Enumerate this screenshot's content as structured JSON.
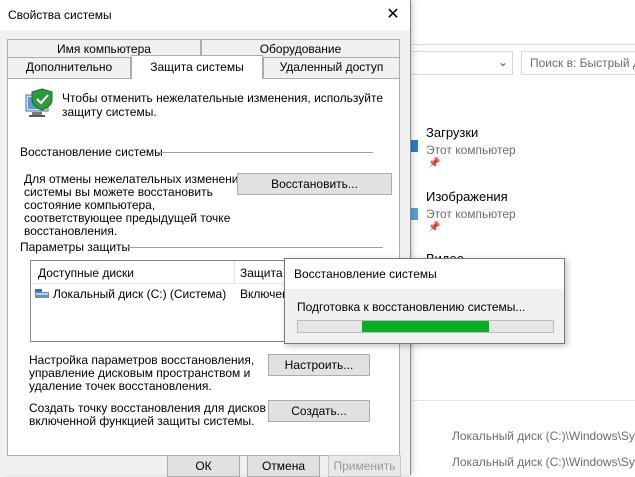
{
  "explorer": {
    "search_placeholder": "Поиск в: Быстрый д",
    "quick_access": [
      {
        "title": "Загрузки",
        "subtitle": "Этот компьютер"
      },
      {
        "title": "Изображения",
        "subtitle": "Этот компьютер"
      },
      {
        "title": "Видео",
        "subtitle": ""
      }
    ],
    "recent_paths": [
      "Локальный диск (C:)\\Windows\\Sy",
      "Локальный диск (C:)\\Windows\\Sy"
    ]
  },
  "dialog": {
    "title": "Свойства системы",
    "tabs_row1": [
      "Имя компьютера",
      "Оборудование"
    ],
    "tabs_row2": [
      "Дополнительно",
      "Защита системы",
      "Удаленный доступ"
    ],
    "active_tab": "Защита системы",
    "intro_line1": "Чтобы отменить нежелательные изменения, используйте",
    "intro_line2": "защиту системы.",
    "restore_group": "Восстановление системы",
    "restore_text": [
      "Для отмены нежелательных изменений",
      "системы вы можете восстановить",
      "состояние компьютера,",
      "соответствующее предыдущей точке",
      "восстановления."
    ],
    "restore_button": "Восстановить...",
    "protection_group": "Параметры защиты",
    "list": {
      "col_drives": "Доступные диски",
      "col_protection": "Защита",
      "rows": [
        {
          "drive": "Локальный диск (C:) (Система)",
          "protection": "Включено"
        }
      ]
    },
    "configure_text": [
      "Настройка параметров восстановления,",
      "управление дисковым пространством и",
      "удаление точек восстановления."
    ],
    "configure_button": "Настроить...",
    "create_text": [
      "Создать точку восстановления для дисков с",
      "включенной функцией защиты системы."
    ],
    "create_button": "Создать...",
    "ok_button": "ОК",
    "cancel_button": "Отмена",
    "apply_button": "Применить"
  },
  "progress_popup": {
    "title": "Восстановление системы",
    "message": "Подготовка к восстановлению системы...",
    "progress_style": "marquee",
    "indicator_color": "#06b025"
  }
}
